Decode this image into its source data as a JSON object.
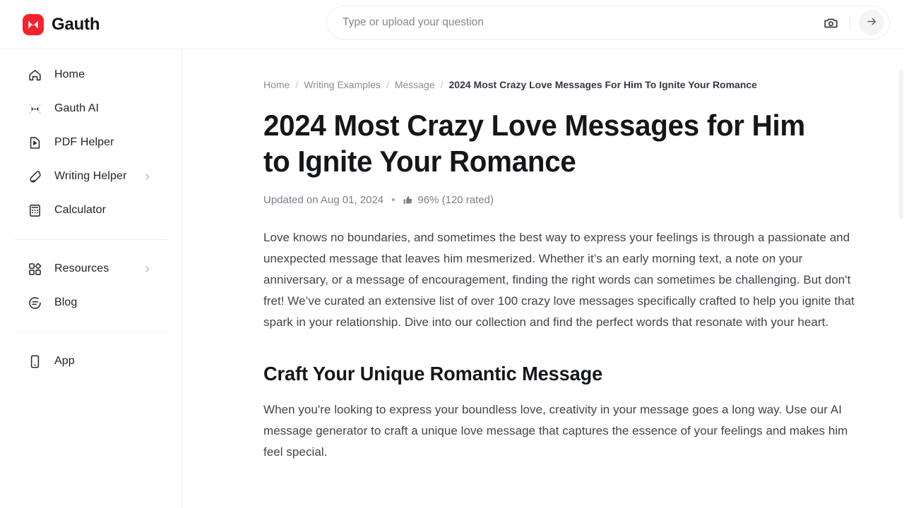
{
  "header": {
    "brand_name": "Gauth",
    "brand_mark_color": "#f5222d",
    "brand_icon": "gauth-butterfly-icon",
    "search": {
      "placeholder": "Type or upload your question",
      "value": "",
      "camera_icon": "camera-icon",
      "submit_icon": "arrow-right-icon"
    }
  },
  "sidebar": {
    "items": [
      {
        "label": "Home",
        "icon": "home-icon",
        "chevron": false
      },
      {
        "label": "Gauth AI",
        "icon": "gauth-ai-icon",
        "chevron": false
      },
      {
        "label": "PDF Helper",
        "icon": "pdf-helper-icon",
        "chevron": false
      },
      {
        "label": "Writing Helper",
        "icon": "pen-icon",
        "chevron": true
      },
      {
        "label": "Calculator",
        "icon": "calculator-icon",
        "chevron": false
      }
    ],
    "items_group2": [
      {
        "label": "Resources",
        "icon": "grid-icon",
        "chevron": true
      },
      {
        "label": "Blog",
        "icon": "speech-bubble-icon",
        "chevron": false
      }
    ],
    "items_group3": [
      {
        "label": "App",
        "icon": "mobile-phone-icon",
        "chevron": false
      }
    ]
  },
  "main": {
    "breadcrumb": [
      {
        "label": "Home",
        "current": false
      },
      {
        "label": "Writing Examples",
        "current": false
      },
      {
        "label": "Message",
        "current": false
      },
      {
        "label": "2024 Most Crazy Love Messages For Him To Ignite Your Romance",
        "current": true
      }
    ],
    "breadcrumb_separator": "/",
    "title": "2024 Most Crazy Love Messages for Him to Ignite Your Romance",
    "meta": {
      "updated": "Updated on Aug 01, 2024",
      "separator": "•",
      "rating_icon": "thumbs-up-icon",
      "rating": "96% (120 rated)"
    },
    "intro_paragraph": "Love knows no boundaries, and sometimes the best way to express your feelings is through a passionate and unexpected message that leaves him mesmerized. Whether it’s an early morning text, a note on your anniversary, or a message of encouragement, finding the right words can sometimes be challenging. But don't fret! We’ve curated an extensive list of over 100 crazy love messages specifically crafted to help you ignite that spark in your relationship. Dive into our collection and find the perfect words that resonate with your heart.",
    "section_heading": "Craft Your Unique Romantic Message",
    "section_paragraph": "When you're looking to express your boundless love, creativity in your message goes a long way. Use our AI message generator to craft a unique love message that captures the essence of your feelings and makes him feel special."
  }
}
